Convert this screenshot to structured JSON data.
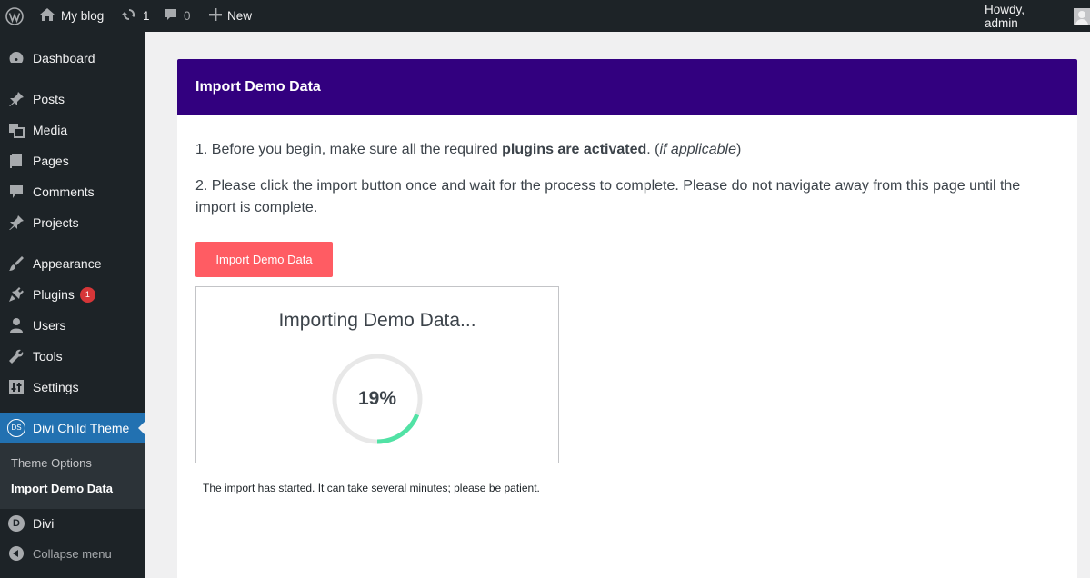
{
  "adminbar": {
    "logo_icon": "wordpress-logo-icon",
    "site_name": "My blog",
    "updates_count": "1",
    "comments_count": "0",
    "new_label": "New",
    "howdy": "Howdy, admin"
  },
  "sidebar": {
    "items": [
      {
        "label": "Dashboard",
        "icon": "dashboard-icon"
      },
      {
        "label": "Posts",
        "icon": "pin-icon"
      },
      {
        "label": "Media",
        "icon": "media-icon"
      },
      {
        "label": "Pages",
        "icon": "pages-icon"
      },
      {
        "label": "Comments",
        "icon": "comment-icon"
      },
      {
        "label": "Projects",
        "icon": "pin-icon"
      },
      {
        "label": "Appearance",
        "icon": "brush-icon"
      },
      {
        "label": "Plugins",
        "icon": "plugin-icon",
        "badge": "1"
      },
      {
        "label": "Users",
        "icon": "user-icon"
      },
      {
        "label": "Tools",
        "icon": "wrench-icon"
      },
      {
        "label": "Settings",
        "icon": "settings-icon"
      },
      {
        "label": "Divi Child Theme",
        "icon": "ds-icon",
        "badge_text": "DS"
      },
      {
        "label": "Divi",
        "icon": "divi-icon",
        "badge_text": "D"
      },
      {
        "label": "Collapse menu",
        "icon": "collapse-icon"
      }
    ],
    "submenu": [
      {
        "label": "Theme Options"
      },
      {
        "label": "Import Demo Data"
      }
    ]
  },
  "main": {
    "header_title": "Import Demo Data",
    "step1_prefix": "1. Before you begin, make sure all the required ",
    "step1_bold": "plugins are activated",
    "step1_mid": ". (",
    "step1_italic": "if applicable",
    "step1_suffix": ")",
    "step2": "2. Please click the import button once and wait for the process to complete. Please do not navigate away from this page until the import is complete.",
    "import_button": "Import Demo Data",
    "progress_title": "Importing Demo Data...",
    "progress_percent": "19%",
    "progress_value": 0.19,
    "note": "The import has started. It can take several minutes; please be patient."
  },
  "colors": {
    "header_bg": "#32007f",
    "button_bg": "#ff5c63",
    "ring_fill": "#51e2a5",
    "ring_track": "#e8e8e8",
    "active_menu": "#2271b1"
  }
}
